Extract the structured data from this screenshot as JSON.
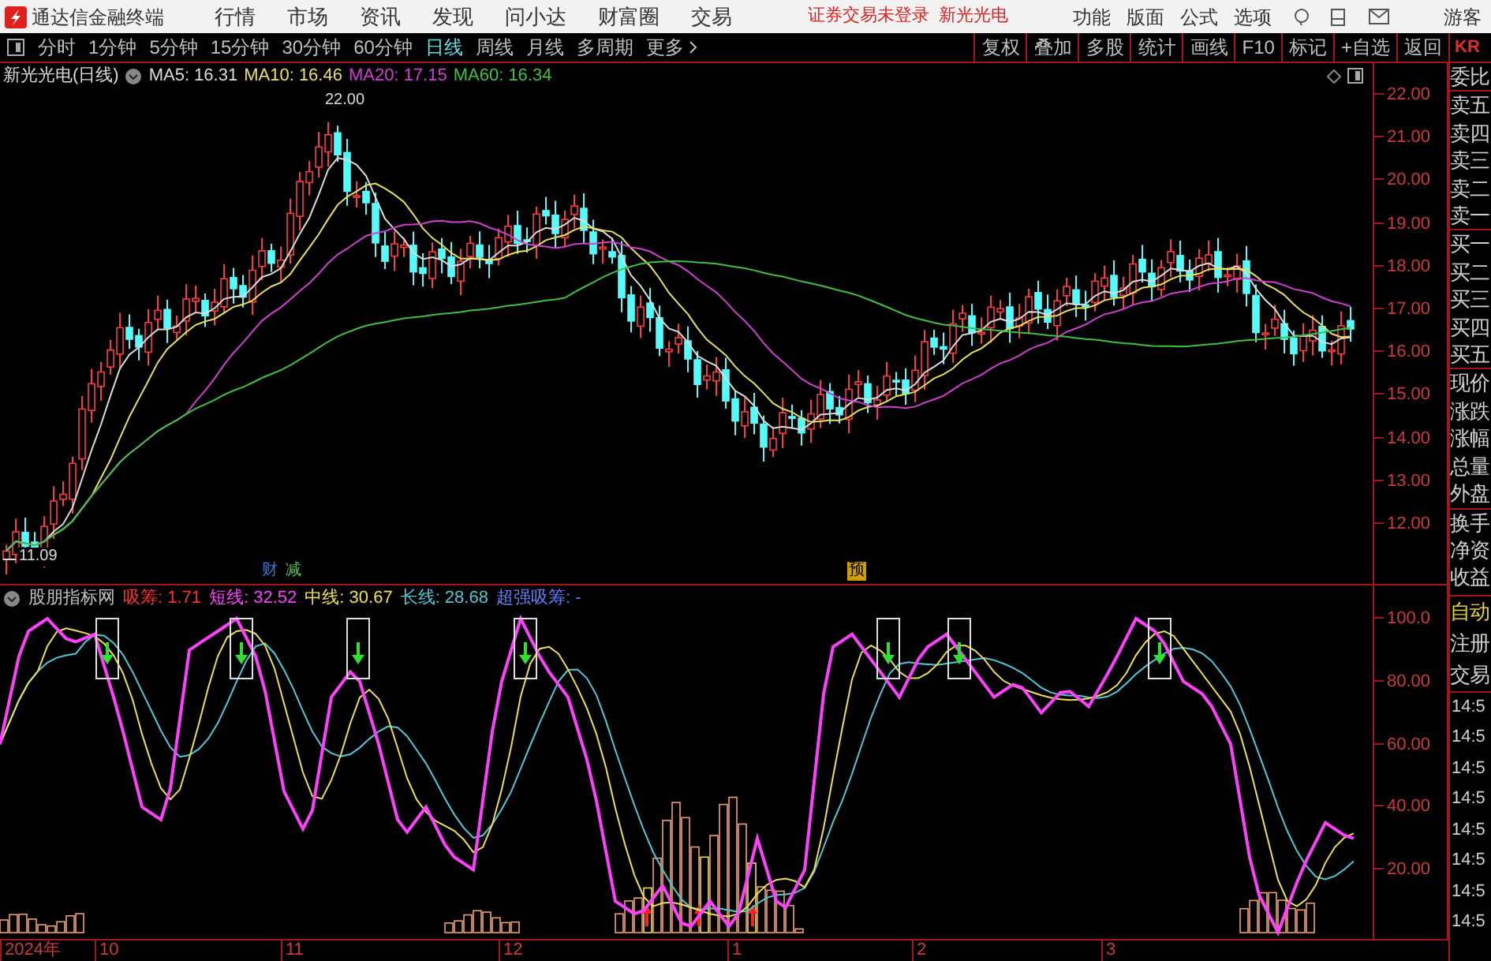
{
  "menu_bar": {
    "app_title": "通达信金融终端",
    "menus": [
      "行情",
      "市场",
      "资讯",
      "发现",
      "问小达",
      "财富圈",
      "交易"
    ],
    "notice": "证券交易未登录",
    "notice_stock": "新光光电",
    "tools": [
      "功能",
      "版面",
      "公式",
      "选项"
    ],
    "user": "游客"
  },
  "toolbar": {
    "periods": [
      {
        "label": "分时",
        "selected": false
      },
      {
        "label": "1分钟",
        "selected": false
      },
      {
        "label": "5分钟",
        "selected": false
      },
      {
        "label": "15分钟",
        "selected": false
      },
      {
        "label": "30分钟",
        "selected": false
      },
      {
        "label": "60分钟",
        "selected": false
      },
      {
        "label": "日线",
        "selected": true
      },
      {
        "label": "周线",
        "selected": false
      },
      {
        "label": "月线",
        "selected": false
      },
      {
        "label": "多周期",
        "selected": false
      },
      {
        "label": "更多",
        "selected": false
      }
    ],
    "actions": [
      "复权",
      "叠加",
      "多股",
      "统计",
      "画线",
      "F10",
      "标记",
      "+自选",
      "返回"
    ],
    "panel_tab": "KR"
  },
  "price_chart": {
    "title": "新光光电(日线)",
    "ma": [
      {
        "label": "MA5: 16.31",
        "color": "#dcdcdc"
      },
      {
        "label": "MA10: 16.46",
        "color": "#e8e060"
      },
      {
        "label": "MA20: 17.15",
        "color": "#d040d0"
      },
      {
        "label": "MA60: 16.34",
        "color": "#40c040"
      }
    ],
    "y_ticks": [
      "22.00",
      "21.00",
      "20.00",
      "19.00",
      "18.00",
      "17.00",
      "16.00",
      "15.00",
      "14.00",
      "13.00",
      "12.00"
    ],
    "high_label": "22.00",
    "low_label": "11.09",
    "markers": [
      {
        "label": "财",
        "kind": "text",
        "color": "#3a78e0"
      },
      {
        "label": "减",
        "kind": "text",
        "color": "#50c850"
      },
      {
        "label": "预",
        "kind": "tag",
        "color": "#d0a000"
      }
    ]
  },
  "indicator": {
    "title": "股朋指标网",
    "values": [
      {
        "label": "吸筹: 1.71",
        "color": "#ff3030"
      },
      {
        "label": "短线: 32.52",
        "color": "#ff40ff"
      },
      {
        "label": "中线: 30.67",
        "color": "#f0e050"
      },
      {
        "label": "长线: 28.68",
        "color": "#50c8d8"
      },
      {
        "label": "超强吸筹: -",
        "color": "#6080ff"
      }
    ],
    "y_ticks": [
      "100.0",
      "80.00",
      "60.00",
      "40.00",
      "20.00"
    ]
  },
  "time_axis": [
    "2024年",
    "10",
    "11",
    "12",
    "1",
    "2",
    "3"
  ],
  "side_panel": {
    "quote_fields": [
      "委比",
      "卖五",
      "卖四",
      "卖三",
      "卖二",
      "卖一",
      "买一",
      "买二",
      "买三",
      "买四",
      "买五",
      "现价",
      "涨跌",
      "涨幅",
      "总量",
      "外盘",
      "换手",
      "净资",
      "收益"
    ],
    "tabs": [
      {
        "label": "自动",
        "selected": true
      },
      {
        "label": "注册",
        "selected": false
      },
      {
        "label": "交易",
        "selected": false
      }
    ],
    "trade_times": [
      "14:5",
      "14:5",
      "14:5",
      "14:5",
      "14:5",
      "14:5",
      "14:5",
      "14:5"
    ]
  }
}
